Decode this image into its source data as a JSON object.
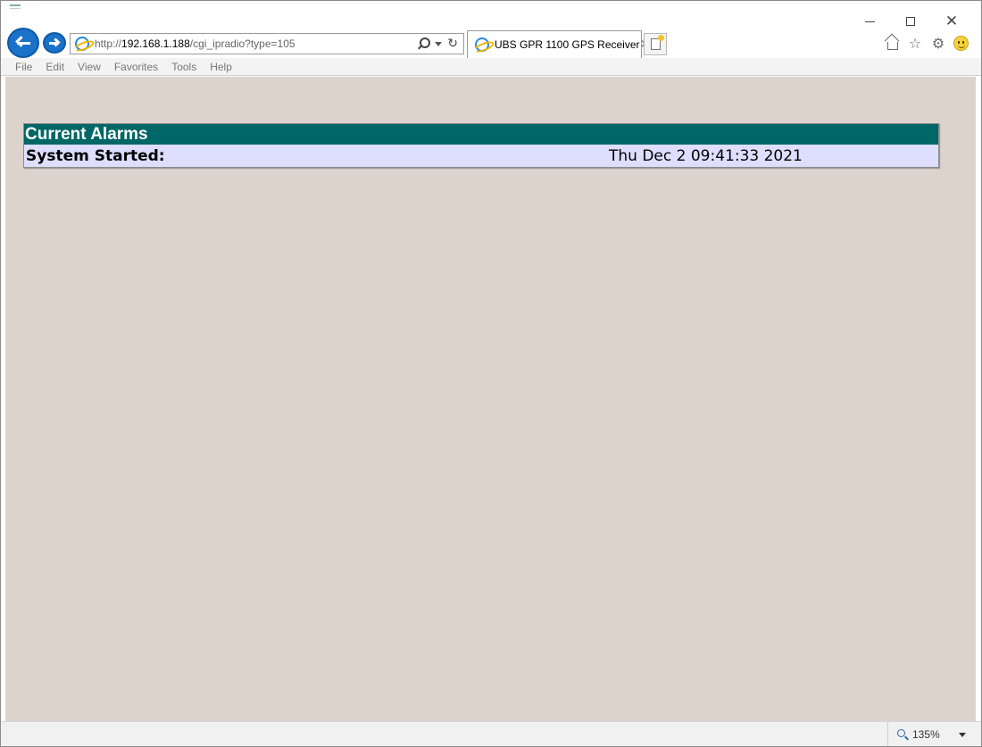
{
  "window": {
    "controls": {
      "minimize": "minimize",
      "maximize": "maximize",
      "close": "✕"
    }
  },
  "addressbar": {
    "url_prefix": "http://",
    "url_host": "192.168.1.188",
    "url_path": "/cgi_ipradio?type=105",
    "refresh_glyph": "↻"
  },
  "tab": {
    "title": "UBS GPR 1100 GPS Receiver",
    "close_glyph": "✕"
  },
  "toolbar_icons": [
    "home-icon",
    "favorites-star-icon",
    "gear-icon",
    "feedback-smiley-icon"
  ],
  "toolbar_glyphs": {
    "star": "☆",
    "gear": "⚙"
  },
  "menu": [
    "File",
    "Edit",
    "View",
    "Favorites",
    "Tools",
    "Help"
  ],
  "page": {
    "table_title": "Current Alarms",
    "rows": [
      {
        "label": "System Started:",
        "value": "Thu Dec 2 09:41:33 2021"
      }
    ]
  },
  "statusbar": {
    "zoom": "135%"
  },
  "colors": {
    "page_background": "#ddd3cd",
    "header_background": "#006666",
    "row_background": "#dedeff",
    "nav_button": "#1a73c9"
  }
}
